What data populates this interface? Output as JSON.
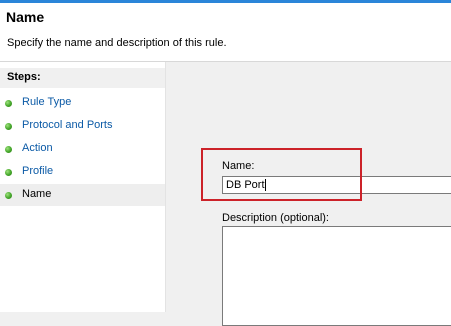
{
  "header": {
    "title": "Name",
    "subtitle": "Specify the name and description of this rule."
  },
  "steps": {
    "title": "Steps:",
    "items": [
      {
        "label": "Rule Type",
        "status": "completed"
      },
      {
        "label": "Protocol and Ports",
        "status": "completed"
      },
      {
        "label": "Action",
        "status": "completed"
      },
      {
        "label": "Profile",
        "status": "completed"
      },
      {
        "label": "Name",
        "status": "current"
      }
    ]
  },
  "form": {
    "name_label": "Name:",
    "name_value": "DB Port",
    "description_label": "Description (optional):",
    "description_value": ""
  },
  "colors": {
    "highlight": "#cc2229",
    "step_link": "#0b5aa6",
    "step_dot": "#44a62a"
  }
}
